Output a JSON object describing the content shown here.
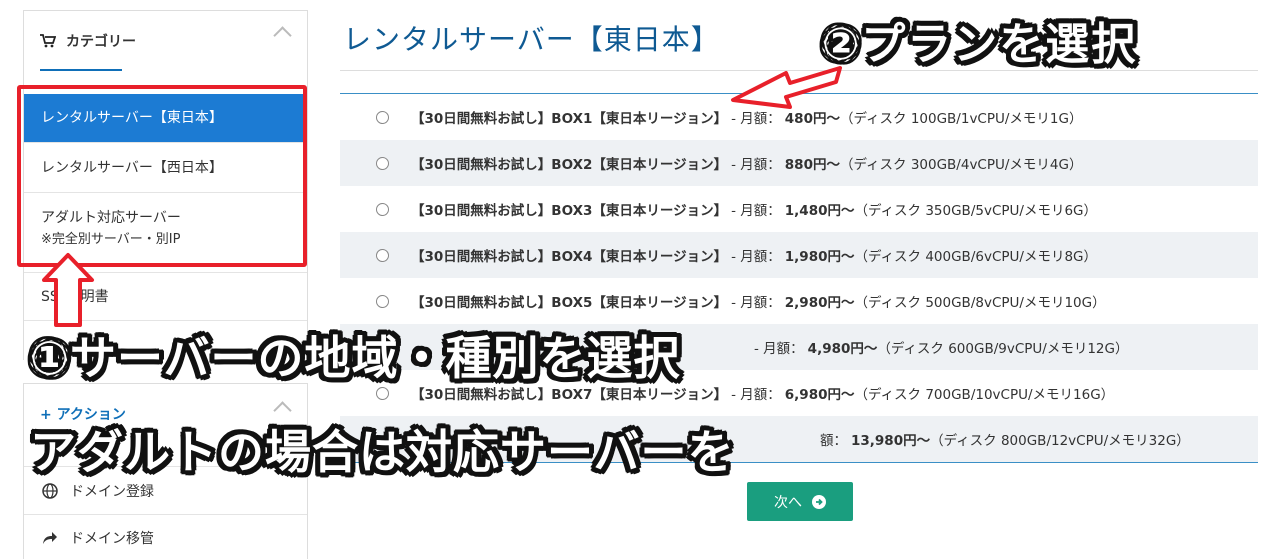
{
  "sidebar": {
    "category_title": "カテゴリー",
    "categories": [
      {
        "label": "レンタルサーバー【東日本】",
        "active": true
      },
      {
        "label": "レンタルサーバー【西日本】",
        "active": false
      },
      {
        "label": "アダルト対応サーバー",
        "sub": "※完全別サーバー・別IP",
        "active": false
      },
      {
        "label": "SSL証明書",
        "active": false
      },
      {
        "label": "",
        "active": false
      }
    ],
    "action_title": "アクション",
    "actions": [
      {
        "label": "ドメイン登録",
        "icon": "globe-icon"
      },
      {
        "label": "ドメイン移管",
        "icon": "share-arrow-icon"
      }
    ]
  },
  "main": {
    "title": "レンタルサーバー【東日本】",
    "plans": [
      {
        "name": "【30日間無料お試し】BOX1【東日本リージョン】",
        "sep": "- 月額：",
        "price": "480円〜",
        "spec": "（ディスク 100GB/1vCPU/メモリ1G）"
      },
      {
        "name": "【30日間無料お試し】BOX2【東日本リージョン】",
        "sep": "- 月額：",
        "price": "880円〜",
        "spec": "（ディスク 300GB/4vCPU/メモリ4G）"
      },
      {
        "name": "【30日間無料お試し】BOX3【東日本リージョン】",
        "sep": "- 月額：",
        "price": "1,480円〜",
        "spec": "（ディスク 350GB/5vCPU/メモリ6G）"
      },
      {
        "name": "【30日間無料お試し】BOX4【東日本リージョン】",
        "sep": "- 月額：",
        "price": "1,980円〜",
        "spec": "（ディスク 400GB/6vCPU/メモリ8G）"
      },
      {
        "name": "【30日間無料お試し】BOX5【東日本リージョン】",
        "sep": "- 月額：",
        "price": "2,980円〜",
        "spec": "（ディスク 500GB/8vCPU/メモリ10G）"
      },
      {
        "name": "",
        "sep": "- 月額：",
        "price": "4,980円〜",
        "spec": "（ディスク 600GB/9vCPU/メモリ12G）"
      },
      {
        "name": "【30日間無料お試し】BOX7【東日本リージョン】",
        "sep": "- 月額：",
        "price": "6,980円〜",
        "spec": "（ディスク 700GB/10vCPU/メモリ16G）"
      },
      {
        "name": "",
        "sep": "額：",
        "price": "13,980円〜",
        "spec": "（ディスク 800GB/12vCPU/メモリ32G）"
      }
    ],
    "next_label": "次へ"
  },
  "annotations": {
    "step2": "②プランを選択",
    "step1": "①サーバーの地域・種別を選択",
    "step1_note": "アダルトの場合は対応サーバーを"
  },
  "colors": {
    "accent_blue": "#1c7bd3",
    "title_blue": "#0f5a93",
    "next_green": "#1a9e7f",
    "annotation_red": "#e8202a"
  }
}
